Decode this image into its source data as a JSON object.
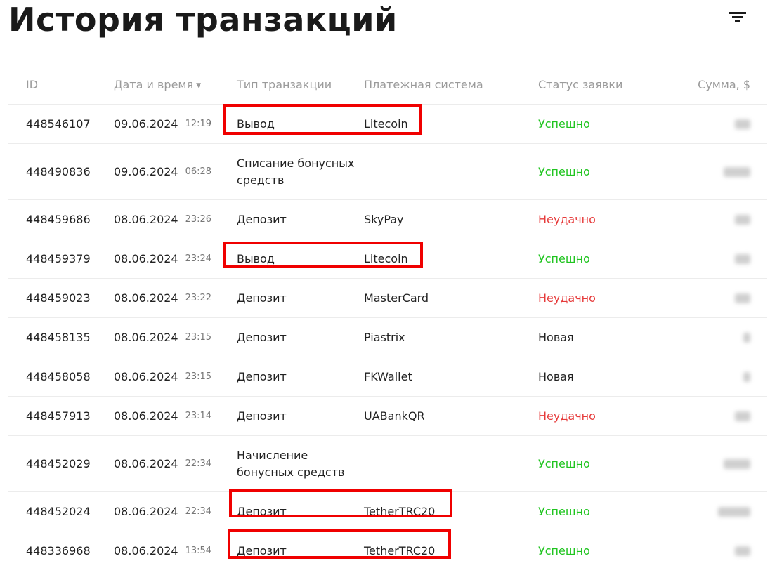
{
  "page": {
    "title": "История транзакций"
  },
  "icons": {
    "filter": "filter-icon"
  },
  "table": {
    "headers": {
      "id": "ID",
      "datetime": "Дата и время",
      "type": "Тип транзакции",
      "system": "Платежная система",
      "status": "Статус заявки",
      "sum": "Сумма, $"
    },
    "rows": [
      {
        "id": "448546107",
        "date": "09.06.2024",
        "time": "12:19",
        "type": "Вывод",
        "system": "Litecoin",
        "status": "Успешно"
      },
      {
        "id": "448490836",
        "date": "09.06.2024",
        "time": "06:28",
        "type": "Списание бонусных средств",
        "system": "",
        "status": "Успешно"
      },
      {
        "id": "448459686",
        "date": "08.06.2024",
        "time": "23:26",
        "type": "Депозит",
        "system": "SkyPay",
        "status": "Неудачно"
      },
      {
        "id": "448459379",
        "date": "08.06.2024",
        "time": "23:24",
        "type": "Вывод",
        "system": "Litecoin",
        "status": "Успешно"
      },
      {
        "id": "448459023",
        "date": "08.06.2024",
        "time": "23:22",
        "type": "Депозит",
        "system": "MasterCard",
        "status": "Неудачно"
      },
      {
        "id": "448458135",
        "date": "08.06.2024",
        "time": "23:15",
        "type": "Депозит",
        "system": "Piastrix",
        "status": "Новая"
      },
      {
        "id": "448458058",
        "date": "08.06.2024",
        "time": "23:15",
        "type": "Депозит",
        "system": "FKWallet",
        "status": "Новая"
      },
      {
        "id": "448457913",
        "date": "08.06.2024",
        "time": "23:14",
        "type": "Депозит",
        "system": "UABankQR",
        "status": "Неудачно"
      },
      {
        "id": "448452029",
        "date": "08.06.2024",
        "time": "22:34",
        "type": "Начисление бонусных средств",
        "system": "",
        "status": "Успешно"
      },
      {
        "id": "448452024",
        "date": "08.06.2024",
        "time": "22:34",
        "type": "Депозит",
        "system": "TetherTRC20",
        "status": "Успешно"
      },
      {
        "id": "448336968",
        "date": "08.06.2024",
        "time": "13:54",
        "type": "Депозит",
        "system": "TetherTRC20",
        "status": "Успешно"
      }
    ]
  },
  "colors": {
    "success": "#1fc41f",
    "fail": "#e63a3a",
    "highlight": "#f00000"
  }
}
